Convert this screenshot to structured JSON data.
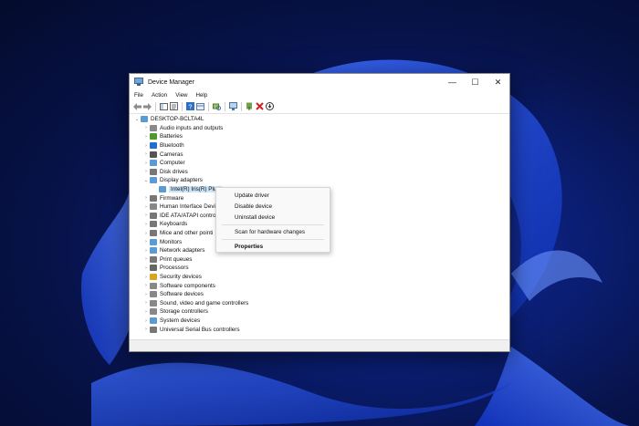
{
  "window": {
    "title": "Device Manager"
  },
  "caption": {
    "minimize": "—",
    "maximize": "☐",
    "close": "✕"
  },
  "menu": [
    "File",
    "Action",
    "View",
    "Help"
  ],
  "toolbar_icons": [
    "back-arrow-icon",
    "forward-arrow-icon",
    "show-hide-console-tree-icon",
    "properties-icon",
    "help-icon",
    "view-icon",
    "scan-hardware-icon",
    "update-driver-icon",
    "uninstall-icon",
    "disable-icon"
  ],
  "tree": {
    "root": "DESKTOP-BCLTA4L",
    "categories": [
      {
        "label": "Audio inputs and outputs",
        "icon": "speaker-icon",
        "color": "#8a8a8a"
      },
      {
        "label": "Batteries",
        "icon": "battery-icon",
        "color": "#4e9a2a"
      },
      {
        "label": "Bluetooth",
        "icon": "bluetooth-icon",
        "color": "#1f6fd1"
      },
      {
        "label": "Cameras",
        "icon": "camera-icon",
        "color": "#555555"
      },
      {
        "label": "Computer",
        "icon": "computer-icon",
        "color": "#5b9bd5"
      },
      {
        "label": "Disk drives",
        "icon": "disk-drive-icon",
        "color": "#777777"
      },
      {
        "label": "Display adapters",
        "icon": "display-adapter-icon",
        "color": "#5b9bd5",
        "expanded": true
      },
      {
        "label": "Intel(R) Iris(R) Plus",
        "icon": "monitor-icon",
        "color": "#5b9bd5",
        "child": true,
        "selected": true
      },
      {
        "label": "Firmware",
        "icon": "firmware-icon",
        "color": "#777777"
      },
      {
        "label": "Human Interface Devic",
        "icon": "hid-icon",
        "color": "#888888"
      },
      {
        "label": "IDE ATA/ATAPI controll",
        "icon": "ide-controller-icon",
        "color": "#777777"
      },
      {
        "label": "Keyboards",
        "icon": "keyboard-icon",
        "color": "#777777"
      },
      {
        "label": "Mice and other pointi",
        "icon": "mouse-icon",
        "color": "#777777"
      },
      {
        "label": "Monitors",
        "icon": "monitor-icon",
        "color": "#5b9bd5"
      },
      {
        "label": "Network adapters",
        "icon": "network-adapter-icon",
        "color": "#5b9bd5"
      },
      {
        "label": "Print queues",
        "icon": "printer-icon",
        "color": "#777777"
      },
      {
        "label": "Processors",
        "icon": "processor-icon",
        "color": "#666666"
      },
      {
        "label": "Security devices",
        "icon": "security-device-icon",
        "color": "#d9a520"
      },
      {
        "label": "Software components",
        "icon": "software-component-icon",
        "color": "#888888"
      },
      {
        "label": "Software devices",
        "icon": "software-device-icon",
        "color": "#888888"
      },
      {
        "label": "Sound, video and game controllers",
        "icon": "sound-icon",
        "color": "#888888"
      },
      {
        "label": "Storage controllers",
        "icon": "storage-controller-icon",
        "color": "#888888"
      },
      {
        "label": "System devices",
        "icon": "system-device-icon",
        "color": "#5b9bd5"
      },
      {
        "label": "Universal Serial Bus controllers",
        "icon": "usb-icon",
        "color": "#777777"
      }
    ]
  },
  "context_menu": {
    "update_driver": "Update driver",
    "disable_device": "Disable device",
    "uninstall_device": "Uninstall device",
    "scan_changes": "Scan for hardware changes",
    "properties": "Properties"
  }
}
